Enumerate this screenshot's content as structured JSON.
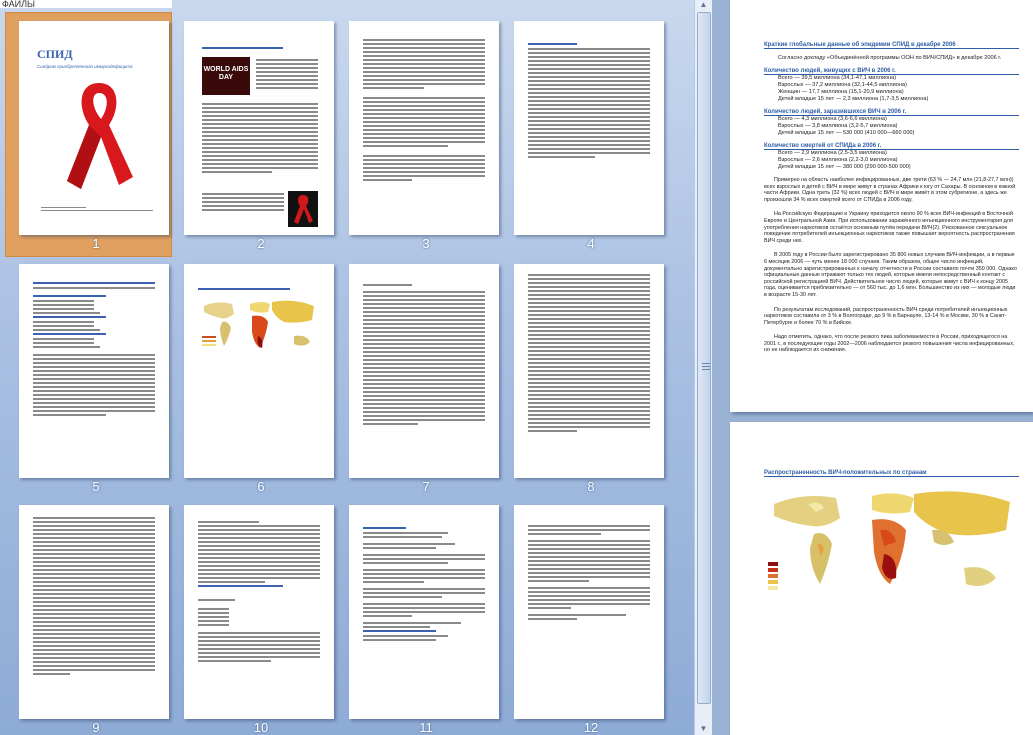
{
  "window": {
    "top_fragment": "ФАЙЛЫ"
  },
  "thumbnails": [
    {
      "number": "1",
      "title": "СПИД",
      "subtitle": "Синдром приобретённого иммунодефицита",
      "selected": true
    },
    {
      "number": "2",
      "image_caption": "WORLD AIDS DAY"
    },
    {
      "number": "3"
    },
    {
      "number": "4"
    },
    {
      "number": "5"
    },
    {
      "number": "6"
    },
    {
      "number": "7"
    },
    {
      "number": "8"
    },
    {
      "number": "9"
    },
    {
      "number": "10"
    },
    {
      "number": "11"
    },
    {
      "number": "12"
    }
  ],
  "preview": {
    "page1": {
      "heading": "Краткие глобальные данные об эпидемии СПИД в декабре 2006",
      "intro": "Согласно докладу «Объединённой программы ООН по ВИЧ/СПИД» в декабре 2006 г.",
      "sections": [
        {
          "title": "Количество людей, живущих с ВИЧ в 2006 г.",
          "lines": [
            "Всего — 39,5 миллиона (34,1-47,1 миллиона)",
            "Взрослых — 37,2 миллиона (32,1-44,5 миллиона)",
            "Женщин — 17,7 миллиона (15,1-20,9 миллиона)",
            "Детей младше 15 лет — 2,3 миллиона (1,7-3,5 миллиона)"
          ]
        },
        {
          "title": "Количество людей, заразившихся ВИЧ в 2006 г.",
          "lines": [
            "Всего — 4,3 миллиона (3,6-6,6 миллиона)",
            "Взрослых — 3,8 миллиона (3,2-5,7 миллиона)",
            "Детей младше 15 лет — 530 000 (410 000—660 000)"
          ]
        },
        {
          "title": "Количество смертей от СПИДа в 2006 г.",
          "lines": [
            "Всего — 2,9 миллиона (2,5-3,5 миллиона)",
            "Взрослых — 2,6 миллиона (2,2-3,0 миллиона)",
            "Детей младше 15 лет — 380 000 (290 000-500 000)"
          ]
        }
      ],
      "paragraphs": [
        "Примерно на область наиболее инфицированных, две трети (63 % — 24,7 млн (21,8-27,7 млн)) всех взрослых и детей с ВИЧ в мире живут в странах Африки к югу от Сахары. В основном в южной части Африки. Одна треть (32 %) всех людей с ВИЧ в мире живёт в этом субрегионе, а здесь же произошли 34 % всех смертей всего от СПИДа в 2006 году.",
        "На Российскую Федерацию и Украину приходится около 90 % всех ВИЧ-инфекций в Восточной Европе и Центральной Азии. При использовании заражённого инъекционного инструментария для употребления наркотиков остаётся основным путём передачи ВИЧ(2). Рискованное сексуальное поведение потребителей инъекционных наркотиков также повышает вероятность распространения ВИЧ среди них.",
        "В 2005 году в России было зарегистрировано 35 800 новых случаев ВИЧ-инфекции, а в первые 6 месяцев 2006 — чуть менее 18 000 случаев. Таким образом, общее число инфекций, документально зарегистрированных к началу отчетности в России составило почти 350 000. Однако официальные данные отражают только тех людей, которые имели непосредственный контакт с российской регистрацией ВИЧ. Действительное число людей, которые живут с ВИЧ к концу 2005 года, оценивается приблизительно — от 560 тыс. до 1,6 млн. Большинство из них — молодые люди в возрасте 15-30 лет.",
        "По результатам исследований, распространенность ВИЧ среди потребителей инъекционных наркотиков составила от 3 % в Волгограде, до 9 % в Барнауле, 13-14 % в Москве, 30 % в Санкт-Петербурге и более 70 % в Бийске.",
        "Надо отметить, однако, что после резкого пика заболеваемости в России, приходящегося на 2001 г., в последующие годы 2002—2006 наблюдается резкого повышения числа инфицированных, но не наблюдается их снижения."
      ]
    },
    "page2": {
      "heading": "Распространенность ВИЧ-положительных по странам"
    }
  }
}
